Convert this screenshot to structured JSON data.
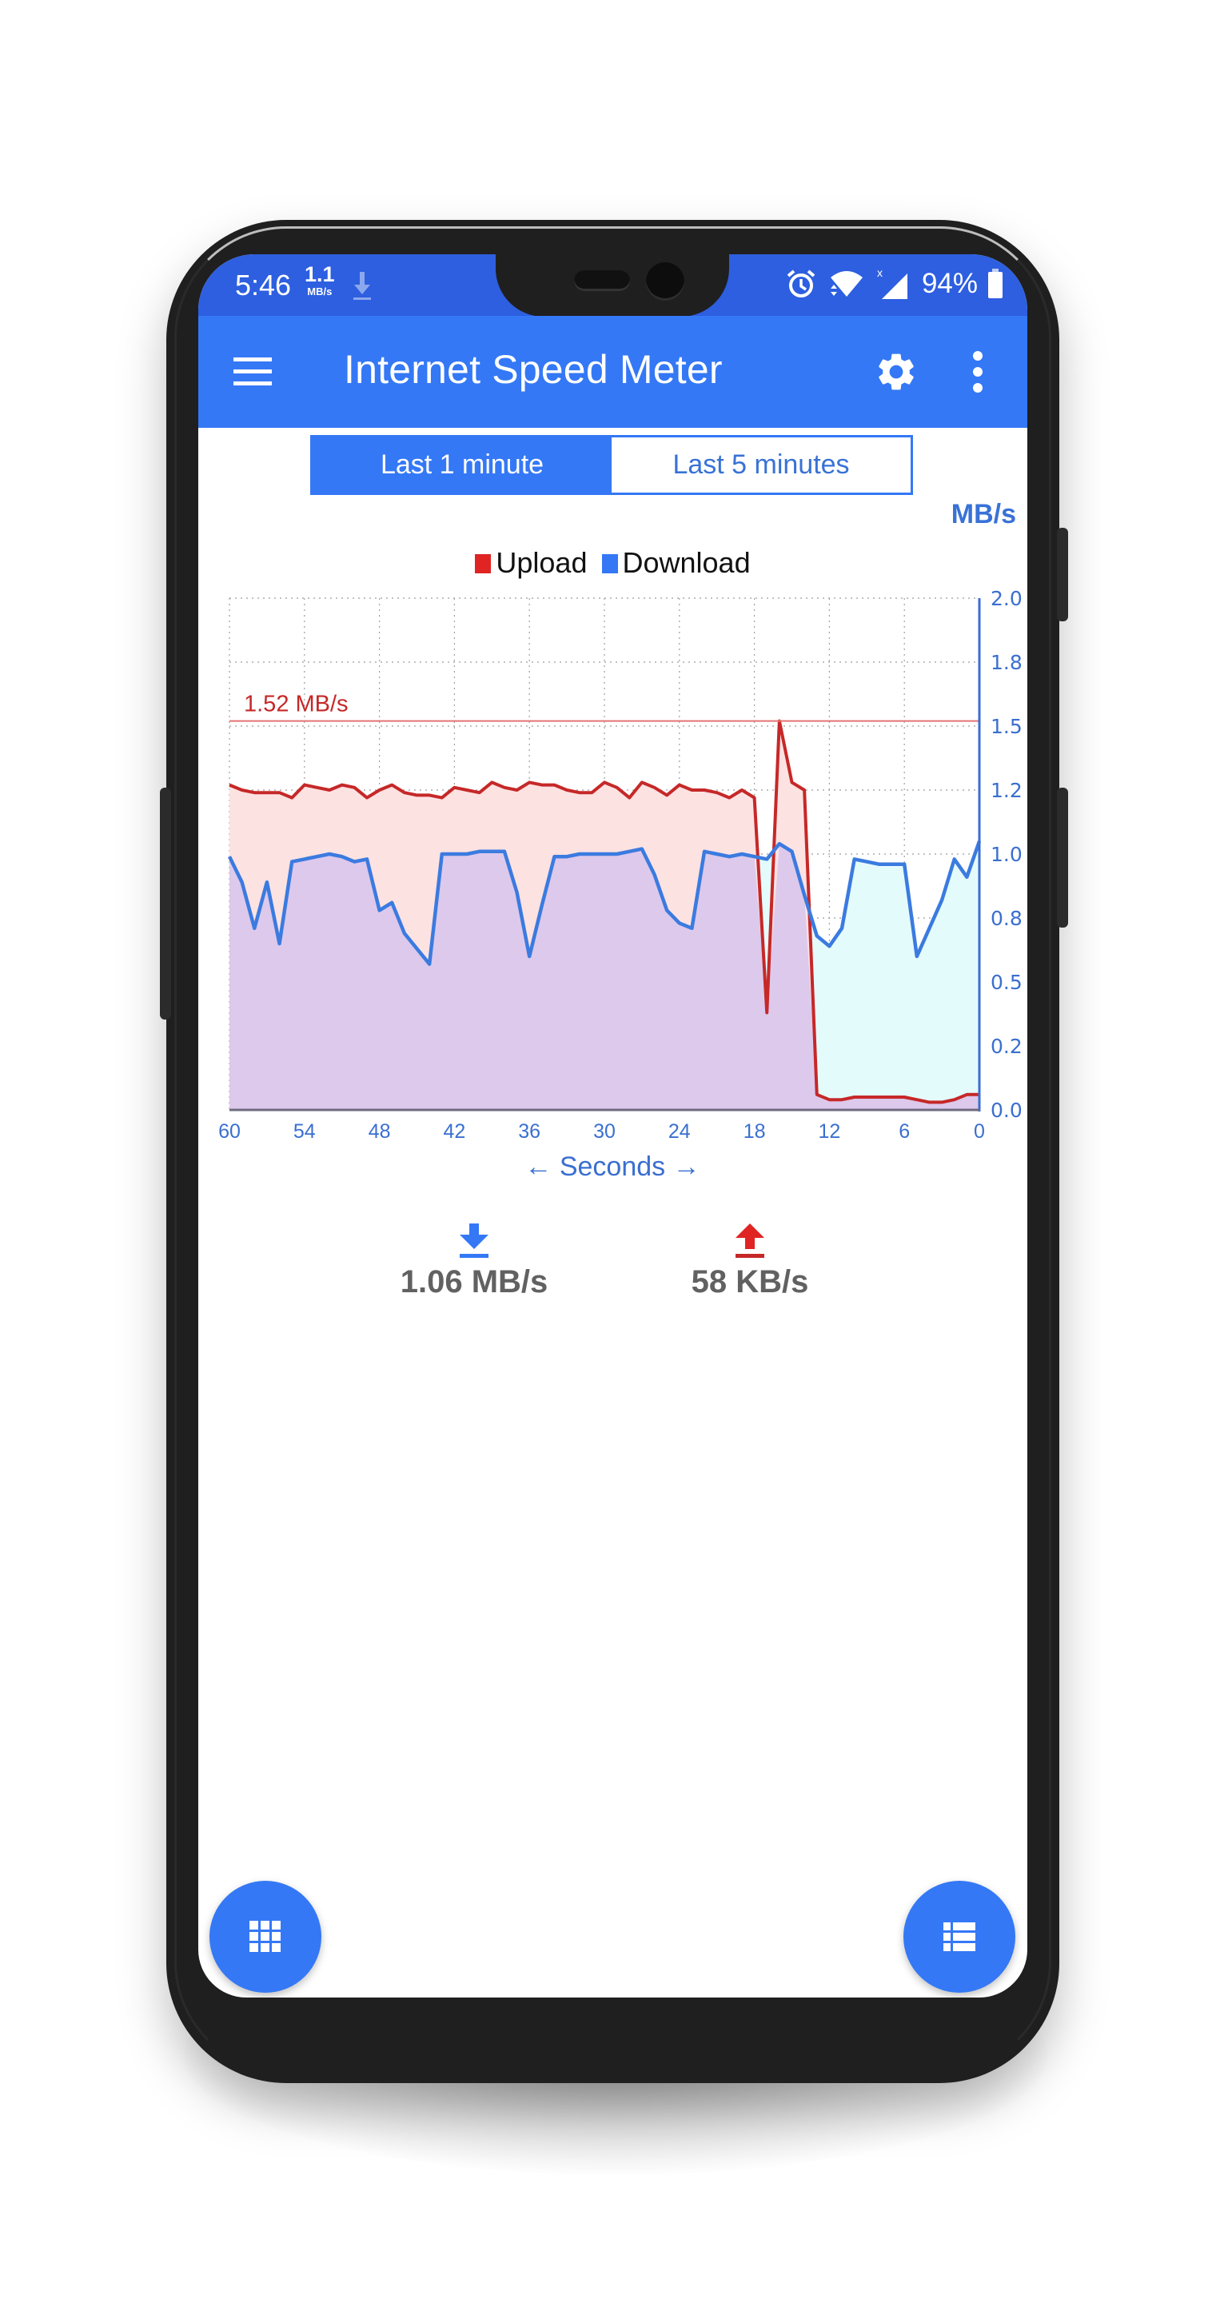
{
  "status_bar": {
    "time": "5:46",
    "net_speed_value": "1.1",
    "net_speed_unit": "MB/s",
    "battery_percent": "94%",
    "icons": [
      "download-notification-icon",
      "alarm-icon",
      "wifi-icon",
      "cell-signal-icon",
      "battery-icon"
    ]
  },
  "app_bar": {
    "title": "Internet Speed Meter",
    "icons": [
      "hamburger-menu-icon",
      "gear-icon",
      "more-vert-icon"
    ]
  },
  "range_toggle": {
    "options": [
      {
        "label": "Last 1 minute",
        "selected": true
      },
      {
        "label": "Last 5 minutes",
        "selected": false
      }
    ]
  },
  "chart_data": {
    "type": "area",
    "unit_label": "MB/s",
    "xlabel": "← Seconds →",
    "ylabel": "MB/s",
    "x_ticks": [
      "60",
      "54",
      "48",
      "42",
      "36",
      "30",
      "24",
      "18",
      "12",
      "6",
      "0"
    ],
    "x_range": [
      60,
      0
    ],
    "y_ticks": [
      {
        "value": 2.0,
        "label": "2.0"
      },
      {
        "value": 1.75,
        "label": "1.8"
      },
      {
        "value": 1.5,
        "label": "1.5"
      },
      {
        "value": 1.25,
        "label": "1.2"
      },
      {
        "value": 1.0,
        "label": "1.0"
      },
      {
        "value": 0.75,
        "label": "0.8"
      },
      {
        "value": 0.5,
        "label": "0.5"
      },
      {
        "value": 0.25,
        "label": "0.2"
      },
      {
        "value": 0.0,
        "label": "0.0"
      }
    ],
    "ylim": [
      0,
      2.0
    ],
    "y_axis_side": "right",
    "grid": true,
    "legend": {
      "placement": "top-center",
      "entries": [
        {
          "name": "Upload",
          "color": "#e02424"
        },
        {
          "name": "Download",
          "color": "#3478f6"
        }
      ]
    },
    "max_marker": {
      "value": 1.52,
      "label": "1.52 MB/s",
      "color": "#c62828"
    },
    "x": [
      60,
      59,
      58,
      57,
      56,
      55,
      54,
      53,
      52,
      51,
      50,
      49,
      48,
      47,
      46,
      45,
      44,
      43,
      42,
      41,
      40,
      39,
      38,
      37,
      36,
      35,
      34,
      33,
      32,
      31,
      30,
      29,
      28,
      27,
      26,
      25,
      24,
      23,
      22,
      21,
      20,
      19,
      18,
      17,
      16,
      15,
      14,
      13,
      12,
      11,
      10,
      9,
      8,
      7,
      6,
      5,
      4,
      3,
      2,
      1,
      0
    ],
    "series": [
      {
        "name": "Upload",
        "line_color": "#c62828",
        "fill_color": "#fde2e2",
        "values": [
          1.27,
          1.25,
          1.24,
          1.24,
          1.24,
          1.22,
          1.27,
          1.26,
          1.25,
          1.27,
          1.26,
          1.22,
          1.25,
          1.27,
          1.24,
          1.23,
          1.23,
          1.22,
          1.26,
          1.25,
          1.24,
          1.28,
          1.26,
          1.25,
          1.28,
          1.27,
          1.27,
          1.25,
          1.24,
          1.24,
          1.28,
          1.26,
          1.22,
          1.28,
          1.26,
          1.23,
          1.27,
          1.25,
          1.25,
          1.24,
          1.22,
          1.25,
          1.22,
          0.38,
          1.52,
          1.28,
          1.25,
          0.06,
          0.04,
          0.04,
          0.05,
          0.05,
          0.05,
          0.05,
          0.05,
          0.04,
          0.03,
          0.03,
          0.04,
          0.06,
          0.06
        ]
      },
      {
        "name": "Download",
        "line_color": "#3b7be0",
        "fill_color": "#e4fbfc",
        "values": [
          0.99,
          0.89,
          0.71,
          0.89,
          0.65,
          0.97,
          0.98,
          0.99,
          1.0,
          0.99,
          0.97,
          0.98,
          0.78,
          0.81,
          0.69,
          0.63,
          0.57,
          1.0,
          1.0,
          1.0,
          1.01,
          1.01,
          1.01,
          0.85,
          0.6,
          0.8,
          0.99,
          0.99,
          1.0,
          1.0,
          1.0,
          1.0,
          1.01,
          1.02,
          0.92,
          0.78,
          0.73,
          0.71,
          1.01,
          1.0,
          0.99,
          1.0,
          0.99,
          0.98,
          1.04,
          1.01,
          0.84,
          0.68,
          0.64,
          0.71,
          0.98,
          0.97,
          0.96,
          0.96,
          0.96,
          0.6,
          0.71,
          0.82,
          0.98,
          0.91,
          1.05
        ]
      }
    ]
  },
  "readouts": {
    "download": {
      "value": "1.06 MB/s",
      "icon": "download-arrow-icon",
      "color": "#3478f6"
    },
    "upload": {
      "value": "58 KB/s",
      "icon": "upload-arrow-icon",
      "color": "#e02424"
    }
  },
  "fabs": [
    {
      "icon": "apps-grid-icon"
    },
    {
      "icon": "view-list-icon"
    }
  ]
}
